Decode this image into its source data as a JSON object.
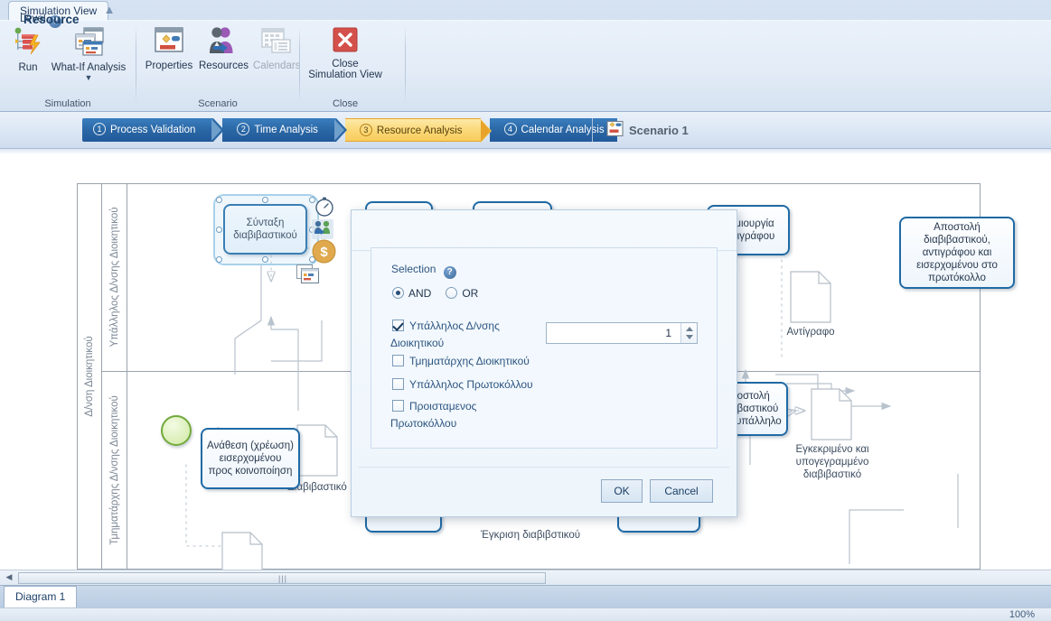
{
  "window": {
    "ribbon_tab": "Simulation View",
    "collapse_icon": "chevron-up-icon"
  },
  "ribbon": {
    "groups": [
      {
        "name": "Simulation",
        "label": "Simulation",
        "buttons": [
          {
            "label": "Run",
            "icon": "run-simulation-icon",
            "enabled": true
          },
          {
            "label": "What-If Analysis",
            "icon": "what-if-analysis-icon",
            "enabled": true,
            "dropdown": "▼"
          }
        ]
      },
      {
        "name": "Scenario",
        "label": "Scenario",
        "buttons": [
          {
            "label": "Properties",
            "icon": "properties-icon",
            "enabled": true
          },
          {
            "label": "Resources",
            "icon": "resources-people-icon",
            "enabled": true
          },
          {
            "label": "Calendars",
            "icon": "calendars-icon",
            "enabled": false
          }
        ]
      },
      {
        "name": "Close",
        "label": "Close",
        "buttons": [
          {
            "label": "Close\nSimulation View",
            "label_line1": "Close",
            "label_line2": "Simulation View",
            "icon": "close-x-icon",
            "enabled": true
          }
        ]
      }
    ]
  },
  "levelbar": {
    "label": "Level",
    "help_icon": "help-question-icon",
    "steps": [
      {
        "num": "1",
        "label": "Process Validation",
        "active": false
      },
      {
        "num": "2",
        "label": "Time Analysis",
        "active": false
      },
      {
        "num": "3",
        "label": "Resource Analysis",
        "active": true
      },
      {
        "num": "4",
        "label": "Calendar Analysis",
        "active": false
      }
    ],
    "scenario": {
      "icon": "scenario-icon",
      "label": "Scenario 1"
    }
  },
  "diagram": {
    "pool_label": "Δ/νση Διοικητικού",
    "lanes": [
      {
        "label": "Υπάλληλος Δ/νσης Διοικητικού"
      },
      {
        "label": "Τμηματάρχης Δ/νσης Διοικητικού"
      }
    ],
    "tasks": [
      {
        "id": "t1",
        "label": "Σύνταξη διαβιβαστικού",
        "selected": true
      },
      {
        "id": "t2",
        "label": "Ανάθεση (χρέωση) εισερχομένου προς κοινοποίηση",
        "selected": false
      },
      {
        "id": "t3",
        "label": "Δημιουργία αντιγράφου",
        "selected": false
      },
      {
        "id": "t4",
        "label": "Αποστολή διαβιβαστικού, αντιγράφου και εισερχομένου στο πρωτόκολλο",
        "selected": false
      },
      {
        "id": "t5",
        "label": "Αποστολή διαβιβαστικού στον υπάλληλο",
        "selected": false
      }
    ],
    "documents": [
      {
        "label": "Διαβιβαστικό"
      },
      {
        "label": "Αντίγραφο"
      },
      {
        "label": "Εγκεκριμένο και υπογεγραμμένο διαβιβαστικό"
      },
      {
        "label": "Έγκριση διαβιβστικού"
      }
    ],
    "badges": [
      {
        "name": "timer-badge-icon"
      },
      {
        "name": "resource-badge-icon"
      },
      {
        "name": "cost-badge-icon"
      }
    ],
    "start_event": "start-event"
  },
  "dialog": {
    "title": "Resource",
    "selection_label": "Selection",
    "help_icon": "help-question-icon",
    "mode": {
      "and": {
        "label": "AND",
        "selected": true
      },
      "or": {
        "label": "OR",
        "selected": false
      }
    },
    "resources": [
      {
        "label_line1": "Υπάλληλος Δ/νσης",
        "label_line2": "Διοικητικού",
        "checked": true
      },
      {
        "label_line1": "Τμηματάρχης Διοικητικού",
        "label_line2": "",
        "checked": false
      },
      {
        "label_line1": "Υπάλληλος Πρωτοκόλλου",
        "label_line2": "",
        "checked": false
      },
      {
        "label_line1": "Προισταμενος",
        "label_line2": "Πρωτοκόλλου",
        "checked": false
      }
    ],
    "quantity": {
      "value": "1",
      "up_icon": "spinner-up-icon",
      "down_icon": "spinner-down-icon"
    },
    "buttons": {
      "ok": "OK",
      "cancel": "Cancel"
    }
  },
  "statusbar": {
    "doc_tab": "Diagram 1",
    "zoom": "100%",
    "scroll_left_icon": "scroll-left-arrow-icon",
    "scroll_grip_icon": "scroll-grip-icon"
  },
  "colors": {
    "accent_blue": "#2a67a5",
    "active_step": "#f8cd5c",
    "task_border": "#1f6aa5",
    "close_red": "#d4504a",
    "start_green": "#72a93c"
  }
}
